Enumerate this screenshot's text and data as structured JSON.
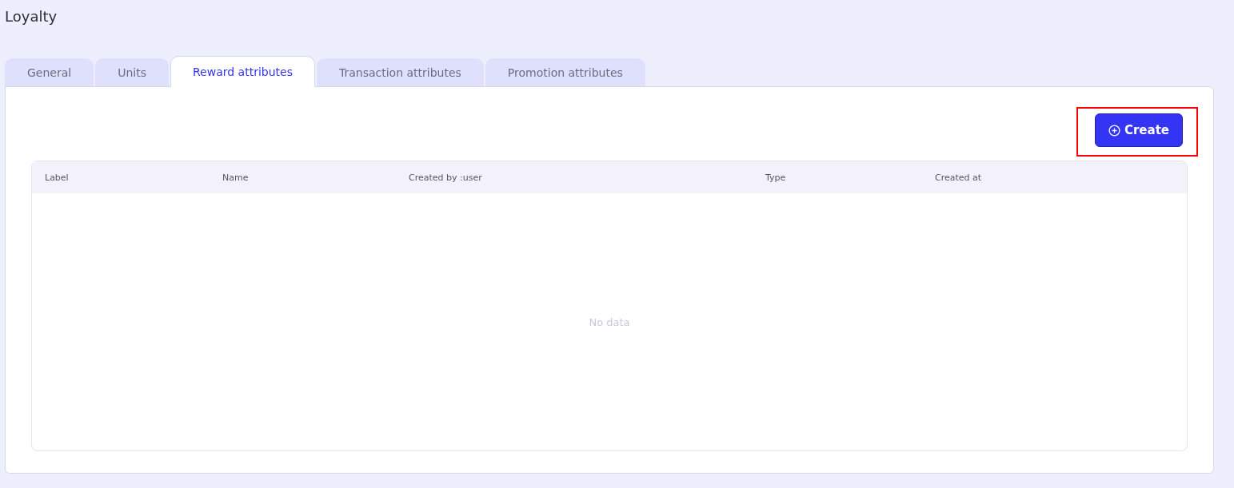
{
  "page": {
    "title": "Loyalty"
  },
  "tabs": [
    {
      "label": "General",
      "selected": false
    },
    {
      "label": "Units",
      "selected": false
    },
    {
      "label": "Reward attributes",
      "selected": true
    },
    {
      "label": "Transaction attributes",
      "selected": false
    },
    {
      "label": "Promotion attributes",
      "selected": false
    }
  ],
  "create_button": {
    "label": "Create",
    "highlighted": true
  },
  "table": {
    "columns": [
      "Label",
      "Name",
      "Created by :user",
      "Type",
      "Created at"
    ],
    "empty_text": "No data"
  }
}
